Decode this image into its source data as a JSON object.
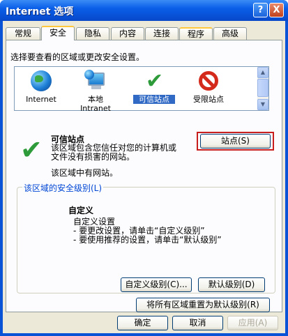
{
  "window": {
    "title": "Internet 选项",
    "help_label": "?",
    "close_label": "X"
  },
  "tabs": [
    {
      "label": "常规"
    },
    {
      "label": "安全"
    },
    {
      "label": "隐私"
    },
    {
      "label": "内容"
    },
    {
      "label": "连接"
    },
    {
      "label": "程序"
    },
    {
      "label": "高级"
    }
  ],
  "security": {
    "prompt": "选择要查看的区域或更改安全设置。",
    "zones": [
      {
        "label": "Internet",
        "icon": "globe-icon"
      },
      {
        "label": "本地\nIntranet",
        "icon": "intranet-icon"
      },
      {
        "label": "可信站点",
        "icon": "check-icon"
      },
      {
        "label": "受限站点",
        "icon": "no-entry-icon"
      }
    ],
    "selected_zone": {
      "title": "可信站点",
      "desc": "该区域包含您信任对您的计算机或文件没有损害的网站。",
      "status": "该区域中有网站。"
    },
    "sites_button": "站点(S)",
    "level_group_label": "该区域的安全级别(L)",
    "custom": {
      "title": "自定义",
      "lines": [
        "自定义设置",
        "- 要更改设置，请单击“自定义级别”",
        "- 要使用推荐的设置，请单击“默认级别”"
      ]
    },
    "custom_level_button": "自定义级别(C)...",
    "default_level_button": "默认级别(D)",
    "reset_all_button": "将所有区域重置为默认级别(R)"
  },
  "dialog": {
    "ok": "确定",
    "cancel": "取消",
    "apply": "应用(A)"
  },
  "colors": {
    "title_bar": "#0a5ee8",
    "highlight_border": "#c81d1d",
    "link_blue": "#0046d5",
    "selection": "#316ac5"
  }
}
